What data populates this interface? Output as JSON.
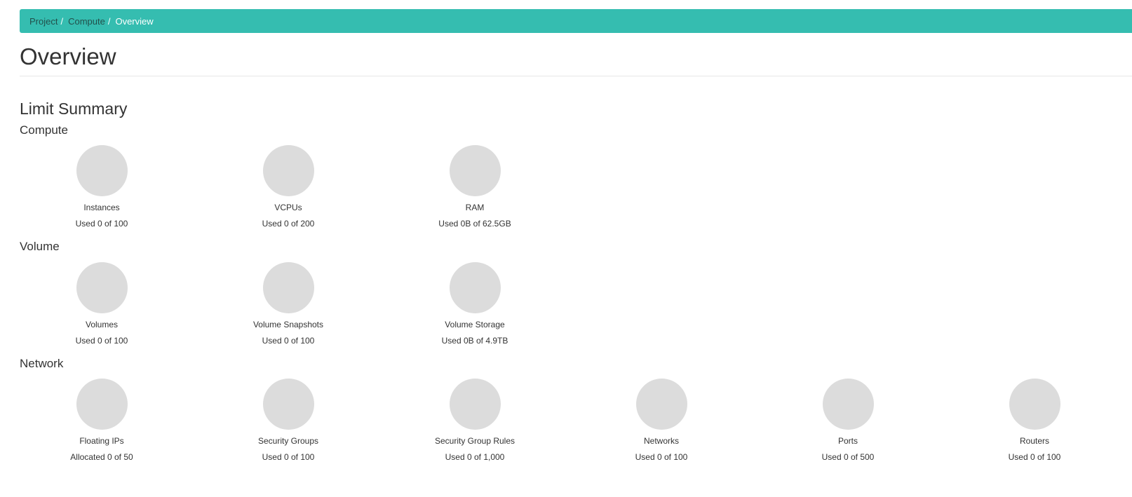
{
  "breadcrumb": {
    "items": [
      "Project",
      "Compute",
      "Overview"
    ],
    "separator": "/"
  },
  "page": {
    "title": "Overview"
  },
  "limit_summary": {
    "title": "Limit Summary",
    "sections": [
      {
        "title": "Compute",
        "charts": [
          {
            "label": "Instances",
            "usage": "Used 0 of 100",
            "used": 0,
            "total": 100
          },
          {
            "label": "VCPUs",
            "usage": "Used 0 of 200",
            "used": 0,
            "total": 200
          },
          {
            "label": "RAM",
            "usage": "Used 0B of 62.5GB",
            "used": 0,
            "total": 62.5
          }
        ]
      },
      {
        "title": "Volume",
        "charts": [
          {
            "label": "Volumes",
            "usage": "Used 0 of 100",
            "used": 0,
            "total": 100
          },
          {
            "label": "Volume Snapshots",
            "usage": "Used 0 of 100",
            "used": 0,
            "total": 100
          },
          {
            "label": "Volume Storage",
            "usage": "Used 0B of 4.9TB",
            "used": 0,
            "total": 4.9
          }
        ]
      },
      {
        "title": "Network",
        "charts": [
          {
            "label": "Floating IPs",
            "usage": "Allocated 0 of 50",
            "used": 0,
            "total": 50
          },
          {
            "label": "Security Groups",
            "usage": "Used 0 of 100",
            "used": 0,
            "total": 100
          },
          {
            "label": "Security Group Rules",
            "usage": "Used 0 of 1,000",
            "used": 0,
            "total": 1000
          },
          {
            "label": "Networks",
            "usage": "Used 0 of 100",
            "used": 0,
            "total": 100
          },
          {
            "label": "Ports",
            "usage": "Used 0 of 500",
            "used": 0,
            "total": 500
          },
          {
            "label": "Routers",
            "usage": "Used 0 of 100",
            "used": 0,
            "total": 100
          }
        ]
      }
    ]
  },
  "colors": {
    "breadcrumb_bg": "#35bdb0",
    "pie_empty": "#dcdcdc",
    "text": "#333333"
  }
}
